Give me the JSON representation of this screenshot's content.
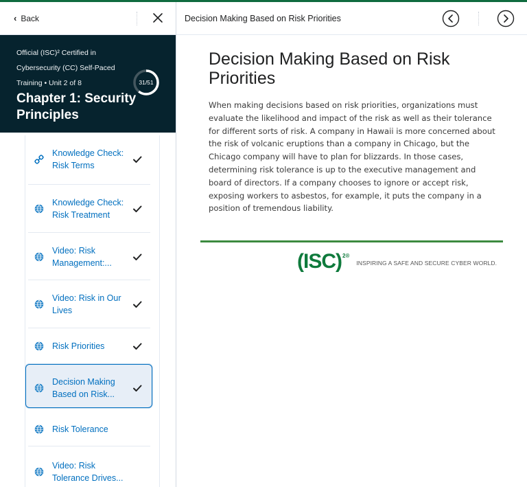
{
  "sidebar": {
    "back_label": "Back",
    "course_title": "Official (ISC)² Certified in Cybersecurity (CC) Self-Paced",
    "unit_line": "Training  •  Unit 2 of 8",
    "chapter_title": "Chapter 1: Security Principles",
    "progress_label": "31/51",
    "progress_fraction": 0.608,
    "items": [
      {
        "label": "Knowledge Check: Risk Terms",
        "icon": "link-icon",
        "completed": true
      },
      {
        "label": "Knowledge Check: Risk Treatment",
        "icon": "globe-icon",
        "completed": true
      },
      {
        "label": "Video: Risk Management:...",
        "icon": "globe-icon",
        "completed": true
      },
      {
        "label": "Video: Risk in Our Lives",
        "icon": "globe-icon",
        "completed": true
      },
      {
        "label": "Risk Priorities",
        "icon": "globe-icon",
        "completed": true
      },
      {
        "label": "Decision Making Based on Risk...",
        "icon": "globe-icon",
        "completed": true,
        "active": true
      },
      {
        "label": "Risk Tolerance",
        "icon": "globe-icon",
        "completed": false
      },
      {
        "label": "Video: Risk Tolerance Drives...",
        "icon": "globe-icon",
        "completed": false
      }
    ]
  },
  "main": {
    "topic_title": "Decision Making Based on Risk Priorities",
    "heading": "Decision Making Based on Risk Priorities",
    "body": "When making decisions based on risk priorities, organizations must evaluate the likelihood and impact of the risk as well as their tolerance for different sorts of risk. A company in Hawaii is more concerned about the risk of volcanic eruptions than a company in Chicago, but the Chicago company will have to plan for blizzards. In those cases, determining risk tolerance is up to the executive management and board of directors. If a company chooses to ignore or accept risk, exposing workers to asbestos, for example, it puts the company in a position of tremendous liability.",
    "logo_text": "(ISC)",
    "logo_sup": "2®",
    "tagline": "INSPIRING A SAFE AND SECURE CYBER WORLD."
  },
  "colors": {
    "accent_green": "#0f6b3f",
    "header_bg": "#06232e",
    "link_blue": "#006fbf",
    "active_bg": "#e7eef7"
  }
}
